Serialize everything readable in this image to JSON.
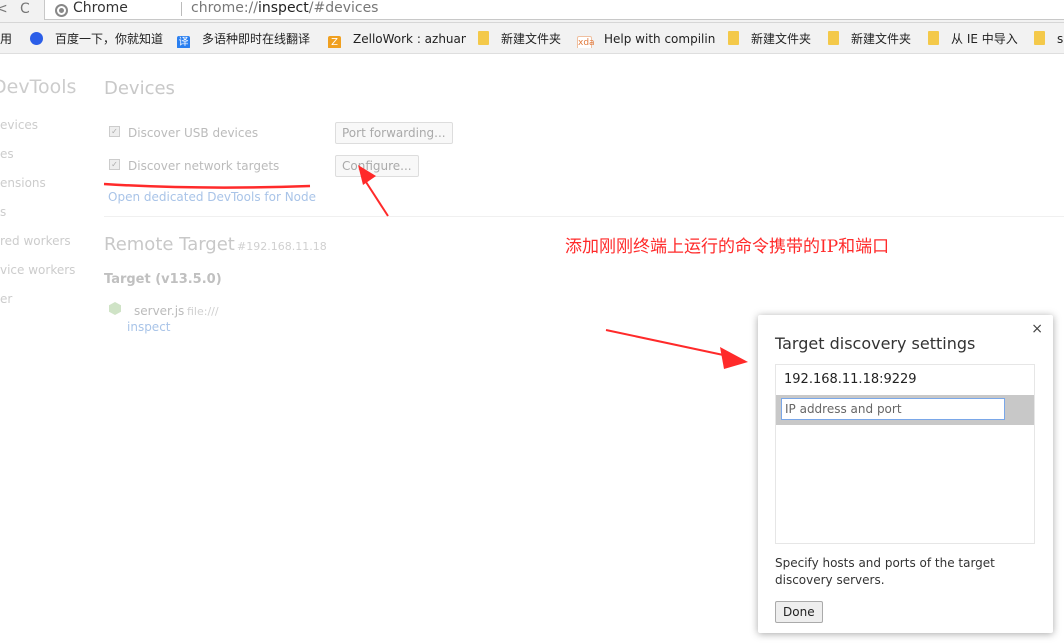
{
  "toolbar": {
    "back_glyph": "<",
    "reload_glyph": "C",
    "site_label": "Chrome",
    "url_prefix": "chrome://",
    "url_host": "inspect",
    "url_rest": "/#devices"
  },
  "bookmarks": [
    {
      "label": "应用",
      "icon": "apps-icon"
    },
    {
      "label": "百度一下，你就知道",
      "icon": "baidu-icon"
    },
    {
      "label": "多语种即时在线翻译",
      "icon": "translate-icon"
    },
    {
      "label": "ZelloWork : azhuan",
      "icon": "zello-icon"
    },
    {
      "label": "新建文件夹",
      "icon": "folder-icon"
    },
    {
      "label": "Help with compilin",
      "icon": "xda-icon"
    },
    {
      "label": "新建文件夹",
      "icon": "folder-icon"
    },
    {
      "label": "新建文件夹",
      "icon": "folder-icon"
    },
    {
      "label": "从 IE 中导入",
      "icon": "folder-icon"
    },
    {
      "label": "s",
      "icon": "folder-icon"
    }
  ],
  "sidebar": {
    "title": "DevTools",
    "items": [
      "evices",
      "es",
      "ensions",
      "s",
      "red workers",
      "vice workers",
      "er"
    ]
  },
  "devices": {
    "title": "Devices",
    "usb_label": "Discover USB devices",
    "port_forwarding_button": "Port forwarding...",
    "network_label": "Discover network targets",
    "configure_button": "Configure...",
    "node_link": "Open dedicated DevTools for Node"
  },
  "remote": {
    "title": "Remote Target",
    "ip": "#192.168.11.18",
    "target_label": "Target (v13.5.0)",
    "file_name": "server.js",
    "file_url": "file:///",
    "inspect_link": "inspect"
  },
  "annotation": {
    "text": "添加刚刚终端上运行的命令携带的IP和端口",
    "color": "#ff2a2a"
  },
  "dialog": {
    "close_glyph": "×",
    "title": "Target discovery settings",
    "entries": [
      "192.168.11.18:9229"
    ],
    "input_placeholder": "IP address and port",
    "description": "Specify hosts and ports of the target discovery servers.",
    "done_button": "Done"
  }
}
